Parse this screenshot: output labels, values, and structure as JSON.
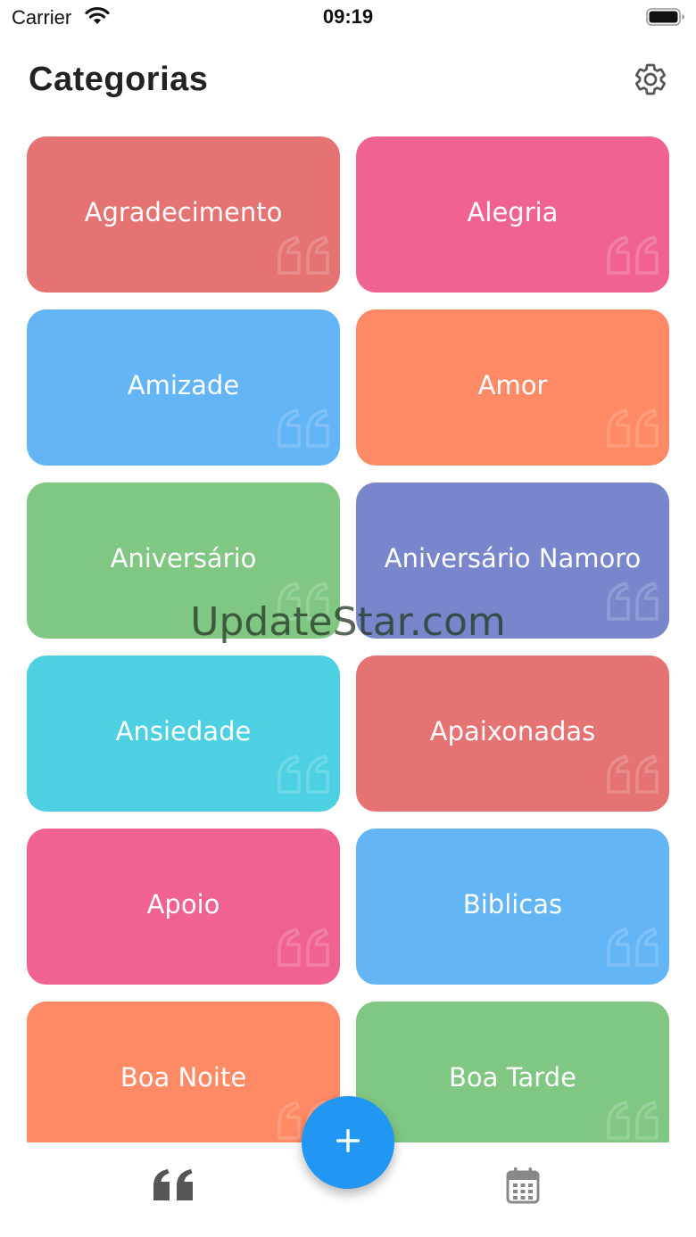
{
  "status_bar": {
    "carrier": "Carrier",
    "time": "09:19"
  },
  "header": {
    "title": "Categorias",
    "settings_icon": "gear-icon"
  },
  "categories": [
    {
      "label": "Agradecimento",
      "color": "#e57373"
    },
    {
      "label": "Alegria",
      "color": "#f06292"
    },
    {
      "label": "Amizade",
      "color": "#64b5f6"
    },
    {
      "label": "Amor",
      "color": "#ff8a65"
    },
    {
      "label": "Aniversário",
      "color": "#81c784"
    },
    {
      "label": "Aniversário Namoro",
      "color": "#7986cb"
    },
    {
      "label": "Ansiedade",
      "color": "#4dd0e1"
    },
    {
      "label": "Apaixonadas",
      "color": "#e57373"
    },
    {
      "label": "Apoio",
      "color": "#f06292"
    },
    {
      "label": "Biblicas",
      "color": "#64b5f6"
    },
    {
      "label": "Boa Noite",
      "color": "#ff8a65"
    },
    {
      "label": "Boa Tarde",
      "color": "#81c784"
    }
  ],
  "card_decoration_icon": "quote-mark-icon",
  "fab": {
    "icon": "plus-icon",
    "color": "#2196f3"
  },
  "bottom_nav": {
    "items": [
      {
        "icon": "quote-icon",
        "color": "#555555"
      },
      {
        "icon": "calendar-icon",
        "color": "#888888"
      }
    ]
  },
  "watermark": "UpdateStar.com"
}
